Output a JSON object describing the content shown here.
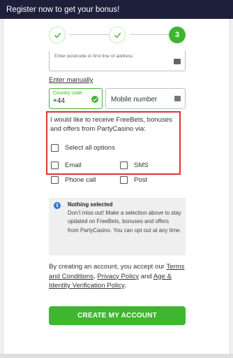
{
  "header": {
    "title": "Register now to get your bonus!"
  },
  "stepper": {
    "steps": [
      {
        "state": "done"
      },
      {
        "state": "done"
      },
      {
        "state": "active",
        "label": "3"
      }
    ]
  },
  "address": {
    "placeholder": "Enter postcode or first line of address",
    "enter_manually_label": "Enter manually"
  },
  "phone": {
    "country_code_label": "Country code",
    "country_code_value": "+44",
    "mobile_placeholder": "Mobile number"
  },
  "offers": {
    "title": "I would like to receive FreeBets, bonuses and offers from PartyCasino via:",
    "select_all_label": "Select all options",
    "options": [
      {
        "label": "Email"
      },
      {
        "label": "SMS"
      },
      {
        "label": "Phone call"
      },
      {
        "label": "Post"
      }
    ]
  },
  "notice": {
    "title": "Nothing selected",
    "body": "Don’t miss out! Make a selection above to stay updated on FreeBets, bonuses and offers from PartyCasino. You can opt out at any time."
  },
  "legal": {
    "prefix": "By creating an account, you accept our",
    "terms": "Terms and Conditions",
    "privacy": "Privacy Policy",
    "and": "and",
    "age": "Age & Identity Verification Policy",
    "suffix": "."
  },
  "cta": {
    "label": "CREATE MY ACCOUNT"
  },
  "colors": {
    "accent": "#3fb62f",
    "header_bg": "#1d1f3b",
    "highlight_border": "#e03131",
    "info": "#2b7bd6"
  }
}
